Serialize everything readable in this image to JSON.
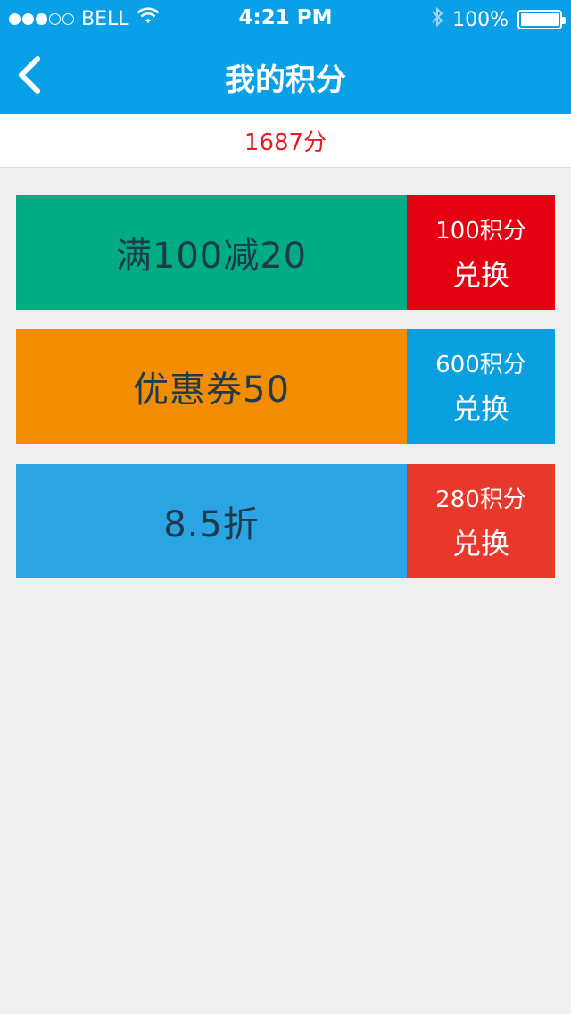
{
  "status_bar": {
    "carrier": "BELL",
    "time": "4:21 PM",
    "battery": "100%",
    "signal_bars_filled": 3,
    "signal_bars_total": 5
  },
  "nav": {
    "title": "我的积分",
    "back_icon": "chevron-left-icon"
  },
  "points": {
    "value": "1687分"
  },
  "coupons": [
    {
      "title": "满100减20",
      "cost": "100积分",
      "action": "兑换",
      "left_color": "#00ad82",
      "right_color": "#e50012"
    },
    {
      "title": "优惠券50",
      "cost": "600积分",
      "action": "兑换",
      "left_color": "#f28c00",
      "right_color": "#0aa0e0"
    },
    {
      "title": "8.5折",
      "cost": "280积分",
      "action": "兑换",
      "left_color": "#2aa4e2",
      "right_color": "#e8382c"
    }
  ],
  "colors": {
    "header": "#0aa0e8",
    "points_text": "#e51c23",
    "background": "#efefef"
  }
}
